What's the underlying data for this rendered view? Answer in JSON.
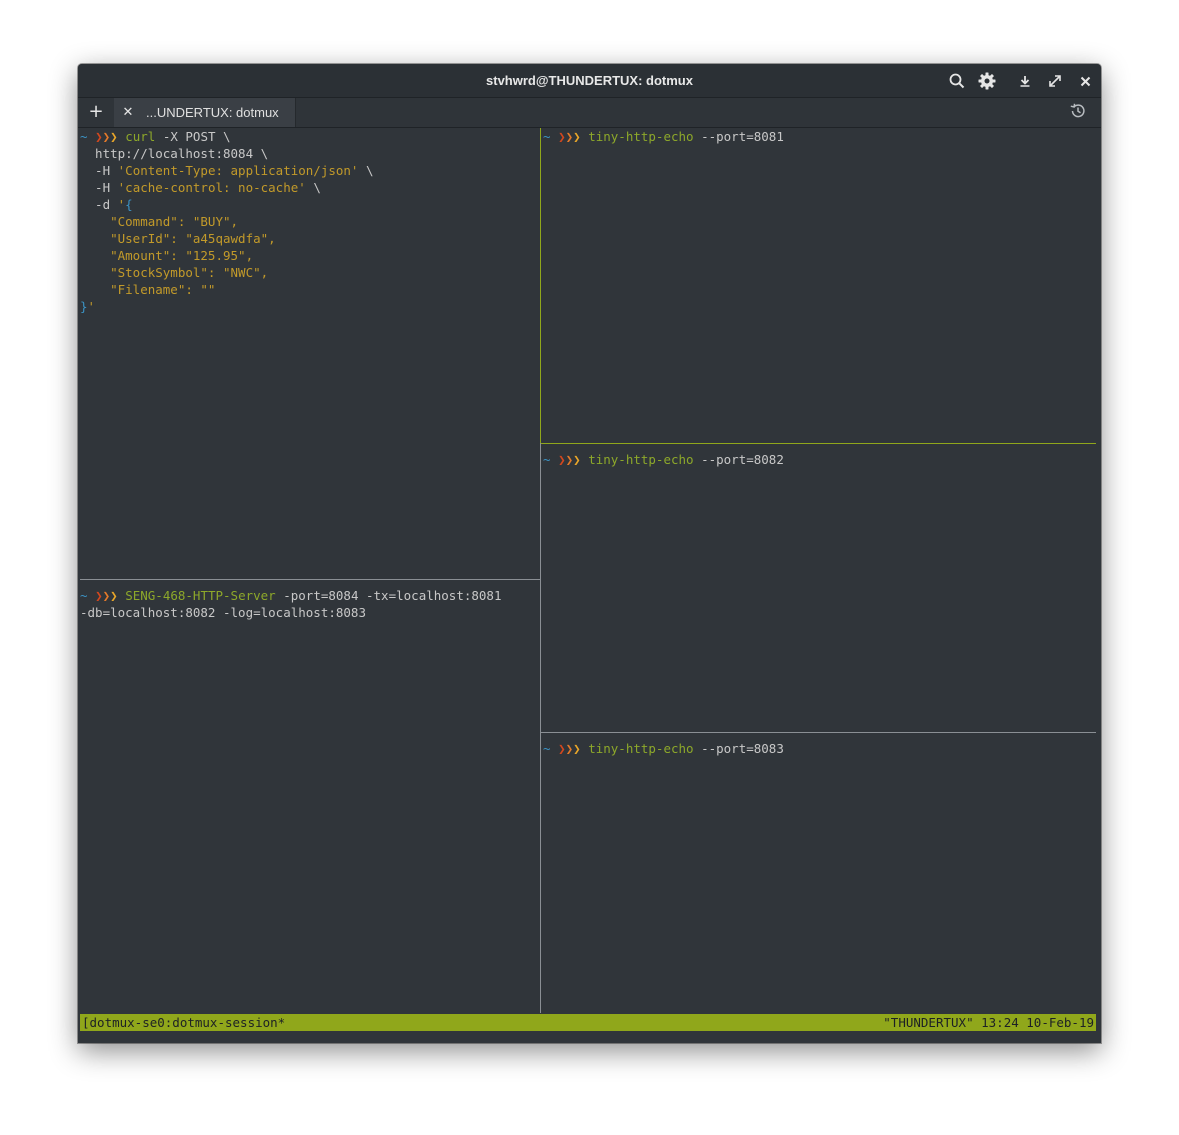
{
  "window": {
    "title": "stvhwrd@THUNDERTUX: dotmux",
    "controls": [
      "search-icon",
      "gear-icon",
      "download-icon",
      "maximize-icon",
      "close-icon"
    ]
  },
  "tabs": {
    "new_tab_label": "+",
    "close_label": "✕",
    "active_tab_label": "...UNDERTUX: dotmux",
    "history_icon": "history-icon"
  },
  "prompt": {
    "tilde": "~",
    "arrow": "❯"
  },
  "colors": {
    "background": "#30353a",
    "accent_green": "#90a71b",
    "tilde_blue": "#3b93c4",
    "string_yellow": "#c29a2a",
    "arrow_red": "#d2471e",
    "arrow_orange": "#e3792a",
    "arrow_yellow": "#e8a62a"
  },
  "panes": {
    "curl": {
      "command": "curl",
      "arg1": " -X POST \\",
      "lines": {
        "l2": "  http://localhost:8084 \\",
        "l3_flag": "  -H ",
        "l3_str": "'Content-Type: application/json'",
        "l3_end": " \\",
        "l4_flag": "  -H ",
        "l4_str": "'cache-control: no-cache'",
        "l4_end": " \\",
        "l5_flag": "  -d ",
        "l5_str": "'",
        "l5_brace": "{",
        "l6": "    \"Command\": \"BUY\",",
        "l7": "    \"UserId\": \"a45qawdfa\",",
        "l8": "    \"Amount\": \"125.95\",",
        "l9": "    \"StockSymbol\": \"NWC\",",
        "l10": "    \"Filename\": \"\"",
        "l11_brace": "}",
        "l11_str": "'"
      }
    },
    "server": {
      "command": "SENG-468-HTTP-Server",
      "args_line1": " -port=8084 -tx=localhost:8081",
      "args_line2": "-db=localhost:8082 -log=localhost:8083"
    },
    "echo1": {
      "command": "tiny-http-echo",
      "args": " --port=8081"
    },
    "echo2": {
      "command": "tiny-http-echo",
      "args": " --port=8082"
    },
    "echo3": {
      "command": "tiny-http-echo",
      "args": " --port=8083"
    }
  },
  "status": {
    "left": "[dotmux-se0:dotmux-session*",
    "right": "\"THUNDERTUX\" 13:24 10-Feb-19"
  }
}
